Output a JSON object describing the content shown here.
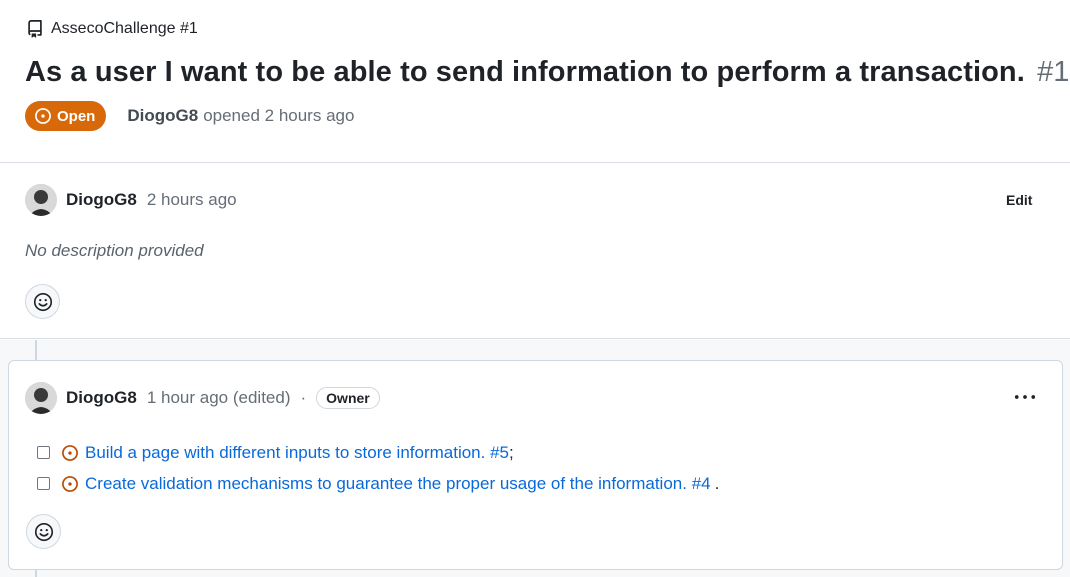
{
  "repo": {
    "name": "AssecoChallenge #1",
    "icon": "repo-icon"
  },
  "issue": {
    "title": "As a user I want to be able to send information to perform a transaction.",
    "number": "#1",
    "state": "Open",
    "author": "DiogoG8",
    "opened_text": "opened 2 hours ago"
  },
  "body": {
    "author": "DiogoG8",
    "time": "2 hours ago",
    "edit_label": "Edit",
    "content": "No description provided",
    "reaction_icon": "smiley-icon"
  },
  "comment": {
    "author": "DiogoG8",
    "time": "1 hour ago (edited)",
    "separator": "·",
    "role": "Owner",
    "more_icon": "kebab-horizontal-icon",
    "tasks": [
      {
        "checked": false,
        "link": "Build a page with different inputs to store information. #5",
        "suffix": ";"
      },
      {
        "checked": false,
        "link": "Create validation mechanisms to guarantee the proper usage of the information. #4",
        "suffix": "."
      }
    ],
    "reaction_icon": "smiley-icon"
  },
  "colors": {
    "open_badge": "#d8690b",
    "link": "#0969da",
    "muted": "#656d76",
    "border": "#d0d7de"
  }
}
